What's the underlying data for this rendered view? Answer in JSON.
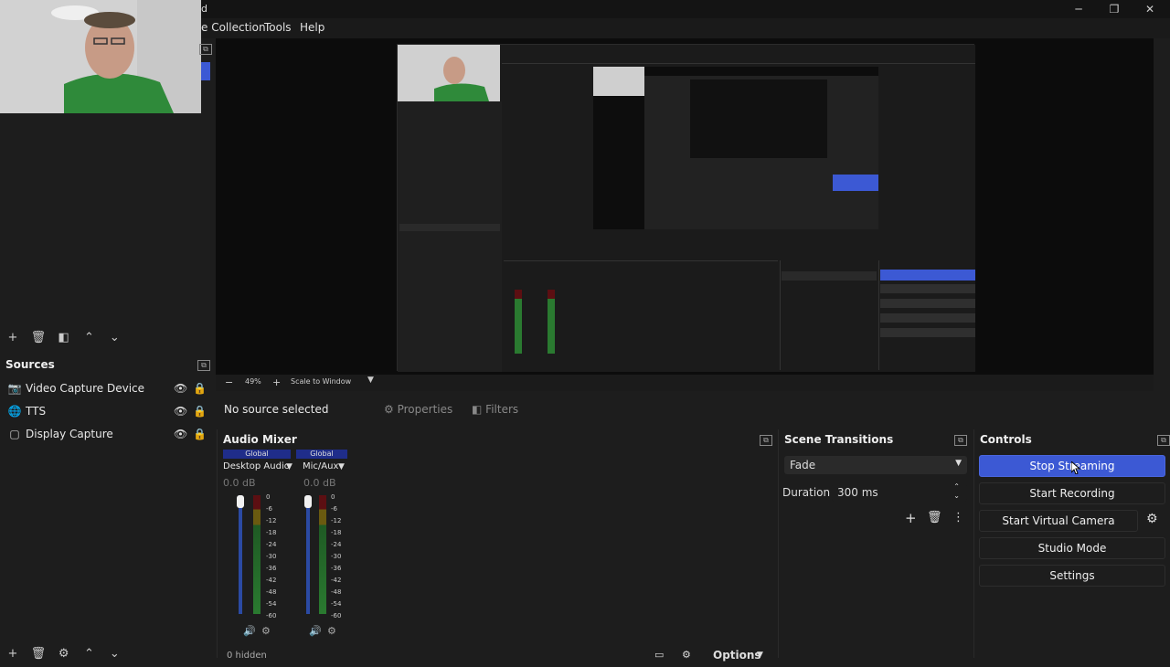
{
  "app": {
    "title_fragment": "d",
    "window_buttons": [
      "─",
      "❐",
      "✕"
    ]
  },
  "menu": [
    "e Collection",
    "Tools",
    "Help"
  ],
  "scene_toolbar": {
    "add": "+",
    "remove": "🗑",
    "filter": "◧",
    "up": "⌃",
    "down": "⌄"
  },
  "sources": {
    "title": "Sources",
    "items": [
      {
        "label": "Video Capture Device",
        "icon": "camera-icon",
        "glyph": "📷"
      },
      {
        "label": "TTS",
        "icon": "globe-icon",
        "glyph": "🌐"
      },
      {
        "label": "Display Capture",
        "icon": "monitor-icon",
        "glyph": "▢"
      }
    ],
    "visibility_glyph": "👁",
    "lock_glyph": "🔒"
  },
  "preview_status": {
    "zoom": "49%",
    "plus": "+",
    "scale_mode": "Scale to Window"
  },
  "properties_bar": {
    "no_source": "No source selected",
    "properties_label": "Properties",
    "filters_label": "Filters"
  },
  "audio_mixer": {
    "title": "Audio Mixer",
    "channels": [
      {
        "global": "Global",
        "name": "Desktop Audio",
        "db": "0.0 dB"
      },
      {
        "global": "Global",
        "name": "Mic/Aux",
        "db": "0.0 dB"
      }
    ],
    "ticks": [
      "0",
      "-6",
      "-12",
      "-18",
      "-24",
      "-30",
      "-36",
      "-42",
      "-48",
      "-54",
      "-60"
    ],
    "hidden_label": "0 hidden",
    "options_label": "Options"
  },
  "scene_transitions": {
    "title": "Scene Transitions",
    "transition": "Fade",
    "duration_label": "Duration",
    "duration_value": "300 ms"
  },
  "controls": {
    "title": "Controls",
    "stop_streaming": "Stop Streaming",
    "start_recording": "Start Recording",
    "start_virtual_camera": "Start Virtual Camera",
    "studio_mode": "Studio Mode",
    "settings": "Settings"
  },
  "colors": {
    "accent": "#3c59d4",
    "panel": "#1d1d1d",
    "preview_bg": "#0c0c0c"
  }
}
